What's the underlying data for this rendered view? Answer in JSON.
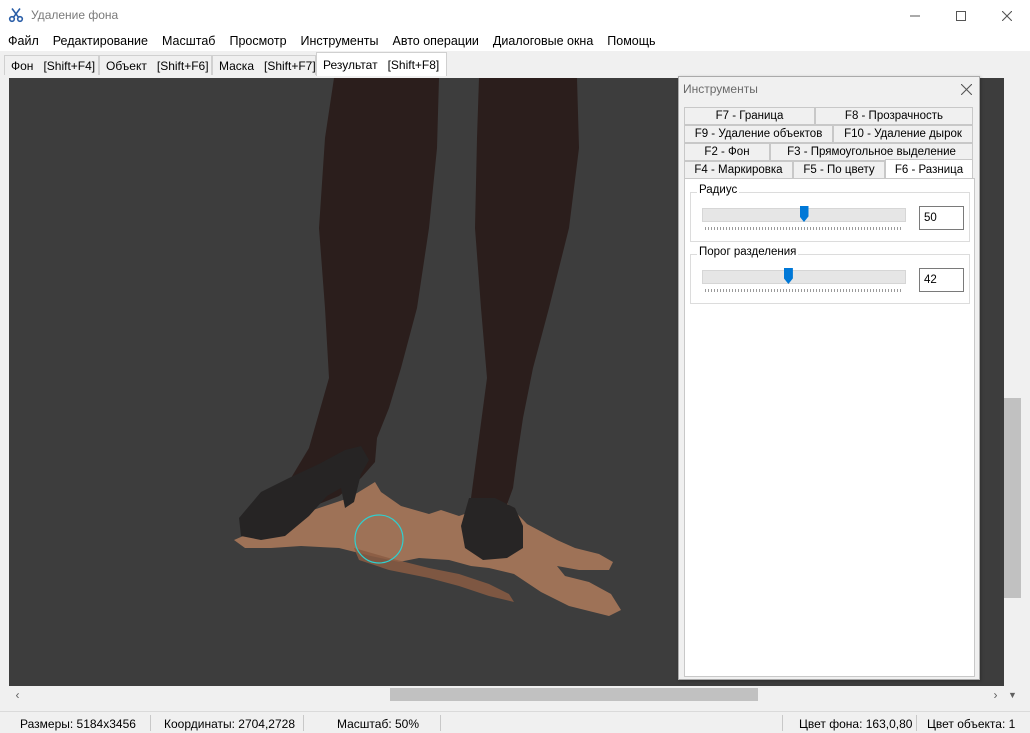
{
  "window": {
    "title": "Удаление фона",
    "icon": "scissors-icon"
  },
  "menu": [
    "Файл",
    "Редактирование",
    "Масштаб",
    "Просмотр",
    "Инструменты",
    "Авто операции",
    "Диалоговые окна",
    "Помощь"
  ],
  "view_tabs": [
    {
      "label": "Фон",
      "shortcut": "[Shift+F4]"
    },
    {
      "label": "Объект",
      "shortcut": "[Shift+F6]"
    },
    {
      "label": "Маска",
      "shortcut": "[Shift+F7]"
    },
    {
      "label": "Результат",
      "shortcut": "[Shift+F8]",
      "active": true
    }
  ],
  "tools": {
    "title": "Инструменты",
    "tabs": {
      "f7": "F7 - Граница",
      "f8": "F8 - Прозрачность",
      "f9": "F9 - Удаление объектов",
      "f10": "F10 - Удаление дырок",
      "f2": "F2 - Фон",
      "f3": "F3 - Прямоугольное выделение",
      "f4": "F4 - Маркировка",
      "f5": "F5 - По цвету",
      "f6": "F6 - Разница"
    },
    "active_tab": "f6",
    "radius": {
      "label": "Радиус",
      "value": "50",
      "level": 0.5
    },
    "threshold": {
      "label": "Порог разделения",
      "value": "42",
      "level": 0.42
    }
  },
  "status": {
    "size": "Размеры: 5184x3456",
    "coords": "Координаты: 2704,2728",
    "zoom": "Масштаб: 50%",
    "bg_color": "Цвет фона: 163,0,80",
    "obj_color": "Цвет объекта: 1"
  },
  "colors": {
    "canvas": "#3d3d3d",
    "accent": "#0078d7",
    "brush_cursor": "#2fd0d0"
  }
}
